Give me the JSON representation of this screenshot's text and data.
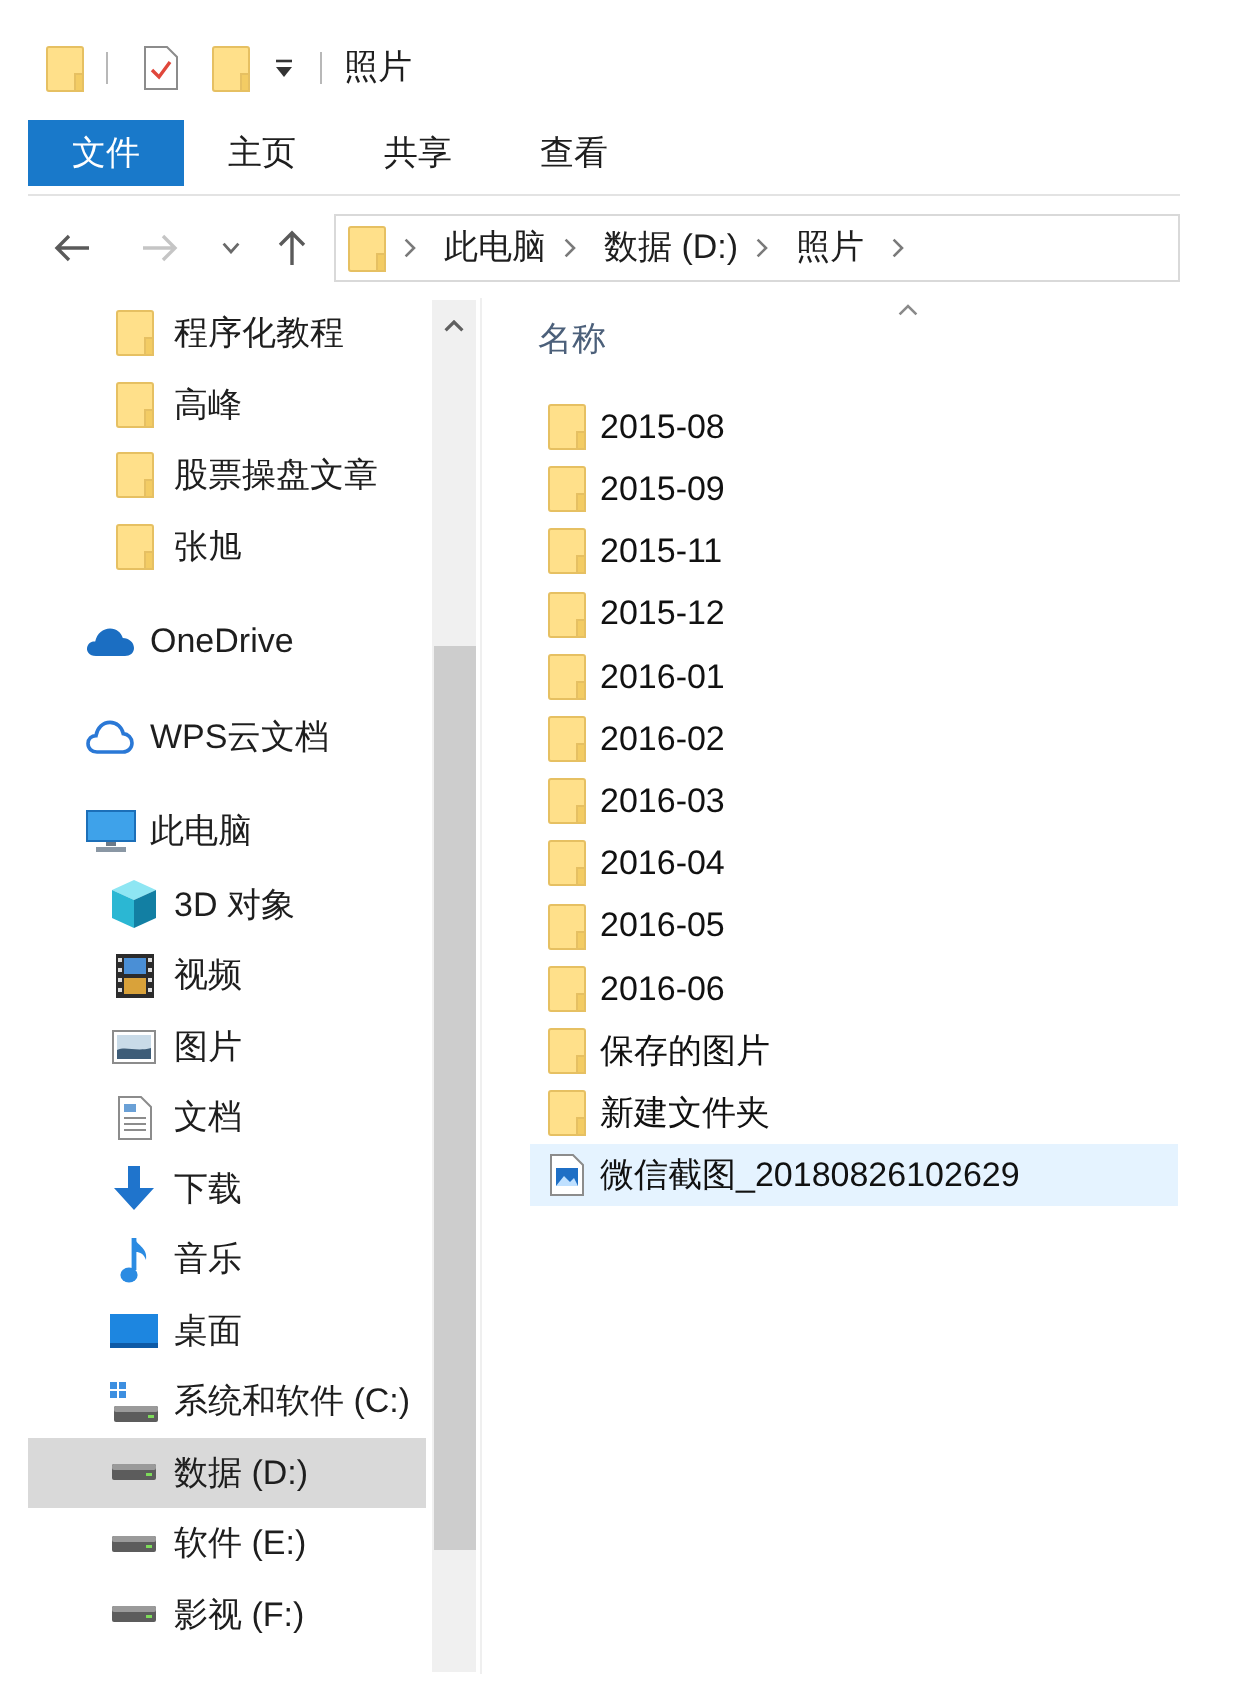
{
  "window": {
    "title": "照片"
  },
  "ribbon": {
    "tabs": [
      {
        "label": "文件",
        "kind": "file",
        "selected": false
      },
      {
        "label": "主页",
        "kind": "tab",
        "selected": false
      },
      {
        "label": "共享",
        "kind": "tab",
        "selected": false
      },
      {
        "label": "查看",
        "kind": "tab",
        "selected": false
      }
    ]
  },
  "navigation": {
    "buttons": [
      {
        "kind": "back",
        "disabled": false
      },
      {
        "kind": "forward",
        "disabled": true
      },
      {
        "kind": "recent",
        "disabled": false
      },
      {
        "kind": "up",
        "disabled": false
      }
    ]
  },
  "address_bar": {
    "segments": [
      "此电脑",
      "数据 (D:)",
      "照片"
    ]
  },
  "sidebar": {
    "quick_access_children": [
      {
        "label": "程序化教程",
        "kind": "folder",
        "selected": false
      },
      {
        "label": "高峰",
        "kind": "folder",
        "selected": false
      },
      {
        "label": "股票操盘文章",
        "kind": "folder",
        "selected": false
      },
      {
        "label": "张旭",
        "kind": "folder",
        "selected": false
      }
    ],
    "items": [
      {
        "label": "OneDrive",
        "kind": "onedrive",
        "selected": false
      },
      {
        "label": "WPS云文档",
        "kind": "cloud",
        "selected": false
      },
      {
        "label": "此电脑",
        "kind": "pc",
        "selected": false,
        "children": [
          {
            "label": "3D 对象",
            "kind": "objects",
            "selected": false
          },
          {
            "label": "视频",
            "kind": "video",
            "selected": false
          },
          {
            "label": "图片",
            "kind": "pictures",
            "selected": false
          },
          {
            "label": "文档",
            "kind": "documents",
            "selected": false
          },
          {
            "label": "下载",
            "kind": "downloads",
            "selected": false
          },
          {
            "label": "音乐",
            "kind": "music",
            "selected": false
          },
          {
            "label": "桌面",
            "kind": "desktop",
            "selected": false
          },
          {
            "label": "系统和软件 (C:)",
            "kind": "system",
            "selected": false
          },
          {
            "label": "数据 (D:)",
            "kind": "drive",
            "selected": true
          },
          {
            "label": "软件 (E:)",
            "kind": "drive",
            "selected": false
          },
          {
            "label": "影视 (F:)",
            "kind": "drive",
            "selected": false
          }
        ]
      }
    ]
  },
  "file_list": {
    "columns": [
      {
        "label": "名称",
        "sort_ascending": true
      }
    ],
    "rows": [
      {
        "name": "2015-08",
        "kind": "folder",
        "selected": false
      },
      {
        "name": "2015-09",
        "kind": "folder",
        "selected": false
      },
      {
        "name": "2015-11",
        "kind": "folder",
        "selected": false
      },
      {
        "name": "2015-12",
        "kind": "folder",
        "selected": false
      },
      {
        "name": "2016-01",
        "kind": "folder",
        "selected": false
      },
      {
        "name": "2016-02",
        "kind": "folder",
        "selected": false
      },
      {
        "name": "2016-03",
        "kind": "folder",
        "selected": false
      },
      {
        "name": "2016-04",
        "kind": "folder",
        "selected": false
      },
      {
        "name": "2016-05",
        "kind": "folder",
        "selected": false
      },
      {
        "name": "2016-06",
        "kind": "folder",
        "selected": false
      },
      {
        "name": "保存的图片",
        "kind": "folder",
        "selected": false
      },
      {
        "name": "新建文件夹",
        "kind": "folder",
        "selected": false
      },
      {
        "name": "微信截图_20180826102629",
        "kind": "image",
        "selected": true
      }
    ]
  }
}
